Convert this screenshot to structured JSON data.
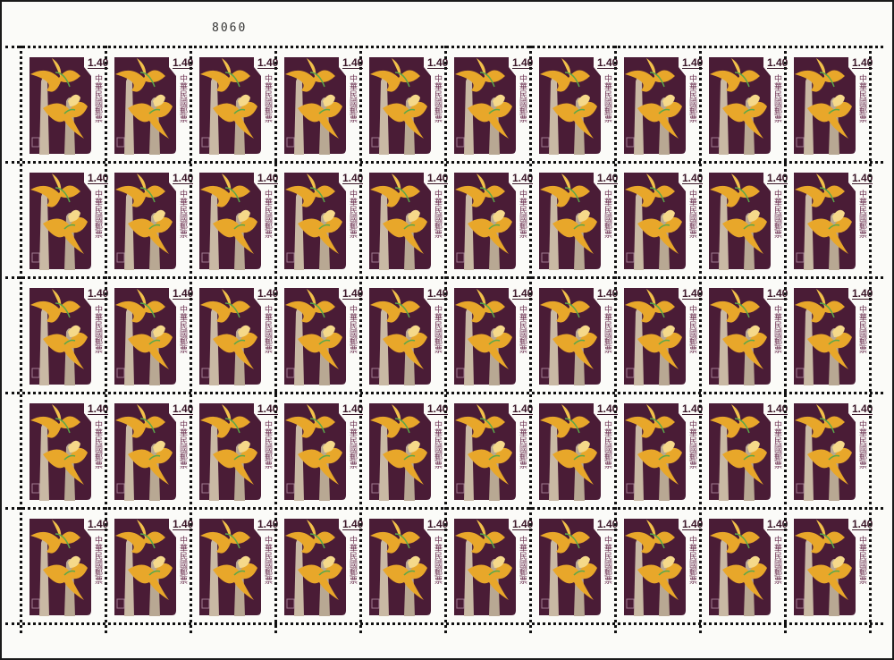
{
  "sheet": {
    "control_number": "8060",
    "rows": 5,
    "columns": 10
  },
  "stamp": {
    "denomination": "1.40",
    "country_text": "中華民國郵票",
    "subject": "orchid",
    "colors": {
      "background": "#4a1c36",
      "flower": "#e8a72a",
      "stem": "#c9b9a4",
      "paper": "#fbfbf8"
    }
  }
}
